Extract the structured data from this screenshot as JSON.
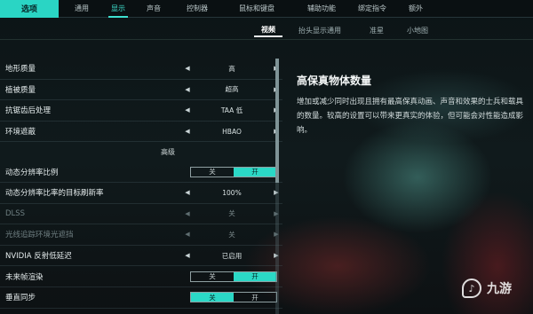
{
  "topnav": {
    "main_label": "选项",
    "tabs": [
      "通用",
      "显示",
      "声音",
      "控制器",
      "鼠标和键盘",
      "辅助功能",
      "绑定指令",
      "额外"
    ],
    "active_index": 1
  },
  "subnav": {
    "tabs": [
      "视频",
      "抬头显示通用",
      "准星",
      "小地图"
    ],
    "active_index": 0
  },
  "settings": {
    "rows": [
      {
        "label": "地形质量",
        "value": "高",
        "kind": "select",
        "dim": false
      },
      {
        "label": "植被质量",
        "value": "超高",
        "kind": "select",
        "dim": false
      },
      {
        "label": "抗锯齿后处理",
        "value": "TAA 低",
        "kind": "select",
        "dim": false
      },
      {
        "label": "环境遮蔽",
        "value": "HBAO",
        "kind": "select",
        "dim": false
      }
    ],
    "section_title": "高级",
    "advanced_rows": [
      {
        "label": "动态分辨率比例",
        "kind": "toggle",
        "off": "关",
        "on": "开",
        "state": "on",
        "dim": false
      },
      {
        "label": "动态分辨率比率的目标刷新率",
        "value": "100%",
        "kind": "select",
        "dim": false
      },
      {
        "label": "DLSS",
        "value": "关",
        "kind": "select",
        "dim": true
      },
      {
        "label": "光线追踪环境光遮挡",
        "value": "关",
        "kind": "select",
        "dim": true
      },
      {
        "label": "NVIDIA 反射低延迟",
        "value": "已启用",
        "kind": "select",
        "dim": false
      },
      {
        "label": "未来帧渲染",
        "kind": "toggle",
        "off": "关",
        "on": "开",
        "state": "on",
        "dim": false
      },
      {
        "label": "垂直同步",
        "kind": "toggle",
        "off": "关",
        "on": "开",
        "state": "off",
        "dim": false
      }
    ]
  },
  "description": {
    "title": "高保真物体数量",
    "body": "增加或减少同时出现且拥有最高保真动画、声音和效果的士兵和载具的数量。较高的设置可以带来更真实的体验，但可能会对性能造成影响。"
  },
  "watermark": {
    "text": "九游",
    "icon": "jiuyou-logo-icon"
  },
  "colors": {
    "accent": "#2bd8c6"
  }
}
